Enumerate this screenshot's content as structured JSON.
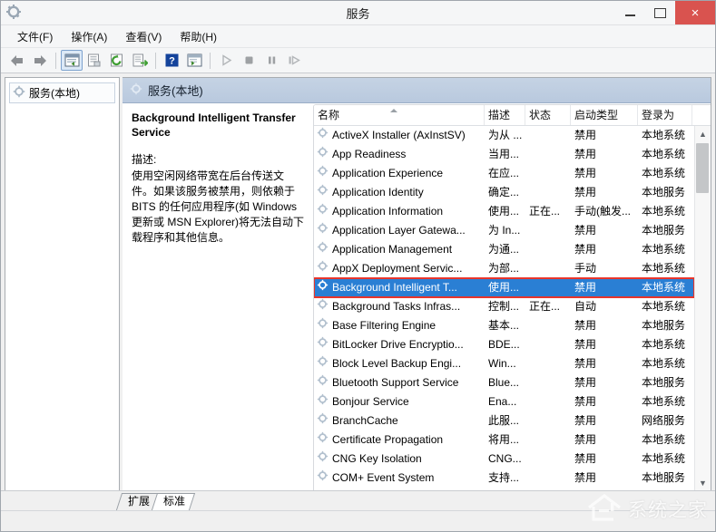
{
  "window": {
    "title": "服务",
    "icon": "gear-icon",
    "minimize_label": "最小化",
    "maximize_label": "最大化",
    "close_label": "×"
  },
  "menu": {
    "items": [
      {
        "label": "文件(F)",
        "name": "menu-file"
      },
      {
        "label": "操作(A)",
        "name": "menu-action"
      },
      {
        "label": "查看(V)",
        "name": "menu-view"
      },
      {
        "label": "帮助(H)",
        "name": "menu-help"
      }
    ]
  },
  "toolbar": {
    "buttons": [
      {
        "icon": "back-arrow-icon",
        "enabled": true
      },
      {
        "icon": "forward-arrow-icon",
        "enabled": true
      },
      {
        "icon": "show-console-tree-icon",
        "enabled": true,
        "active": true
      },
      {
        "icon": "properties-icon",
        "enabled": true
      },
      {
        "icon": "refresh-icon",
        "enabled": true
      },
      {
        "icon": "export-list-icon",
        "enabled": true
      },
      {
        "icon": "help-icon",
        "enabled": true
      },
      {
        "icon": "show-hide-action-pane-icon",
        "enabled": true
      },
      {
        "icon": "start-service-icon",
        "enabled": false
      },
      {
        "icon": "stop-service-icon",
        "enabled": false
      },
      {
        "icon": "pause-service-icon",
        "enabled": false
      },
      {
        "icon": "resume-service-icon",
        "enabled": false
      }
    ]
  },
  "tree": {
    "items": [
      {
        "label": "服务(本地)",
        "icon": "gear-icon"
      }
    ]
  },
  "pane": {
    "header_title": "服务(本地)",
    "header_icon": "gear-icon"
  },
  "detail": {
    "title": "Background Intelligent Transfer Service",
    "description_label": "描述:",
    "description_body": "使用空闲网络带宽在后台传送文件。如果该服务被禁用，则依赖于 BITS 的任何应用程序(如 Windows 更新或 MSN Explorer)将无法自动下载程序和其他信息。"
  },
  "list": {
    "columns": [
      {
        "label": "名称",
        "name": "column-name",
        "sorted": "asc"
      },
      {
        "label": "描述",
        "name": "column-description"
      },
      {
        "label": "状态",
        "name": "column-status"
      },
      {
        "label": "启动类型",
        "name": "column-startup-type"
      },
      {
        "label": "登录为",
        "name": "column-log-on-as"
      }
    ],
    "rows": [
      {
        "name": "ActiveX Installer (AxInstSV)",
        "desc": "为从 ...",
        "state": "",
        "start": "禁用",
        "logon": "本地系统",
        "selected": false
      },
      {
        "name": "App Readiness",
        "desc": "当用...",
        "state": "",
        "start": "禁用",
        "logon": "本地系统",
        "selected": false
      },
      {
        "name": "Application Experience",
        "desc": "在应...",
        "state": "",
        "start": "禁用",
        "logon": "本地系统",
        "selected": false
      },
      {
        "name": "Application Identity",
        "desc": "确定...",
        "state": "",
        "start": "禁用",
        "logon": "本地服务",
        "selected": false
      },
      {
        "name": "Application Information",
        "desc": "使用...",
        "state": "正在...",
        "start": "手动(触发...",
        "logon": "本地系统",
        "selected": false
      },
      {
        "name": "Application Layer Gatewa...",
        "desc": "为 In...",
        "state": "",
        "start": "禁用",
        "logon": "本地服务",
        "selected": false
      },
      {
        "name": "Application Management",
        "desc": "为通...",
        "state": "",
        "start": "禁用",
        "logon": "本地系统",
        "selected": false
      },
      {
        "name": "AppX Deployment Servic...",
        "desc": "为部...",
        "state": "",
        "start": "手动",
        "logon": "本地系统",
        "selected": false
      },
      {
        "name": "Background Intelligent T...",
        "desc": "使用...",
        "state": "",
        "start": "禁用",
        "logon": "本地系统",
        "selected": true
      },
      {
        "name": "Background Tasks Infras...",
        "desc": "控制...",
        "state": "正在...",
        "start": "自动",
        "logon": "本地系统",
        "selected": false
      },
      {
        "name": "Base Filtering Engine",
        "desc": "基本...",
        "state": "",
        "start": "禁用",
        "logon": "本地服务",
        "selected": false
      },
      {
        "name": "BitLocker Drive Encryptio...",
        "desc": "BDE...",
        "state": "",
        "start": "禁用",
        "logon": "本地系统",
        "selected": false
      },
      {
        "name": "Block Level Backup Engi...",
        "desc": "Win...",
        "state": "",
        "start": "禁用",
        "logon": "本地系统",
        "selected": false
      },
      {
        "name": "Bluetooth Support Service",
        "desc": "Blue...",
        "state": "",
        "start": "禁用",
        "logon": "本地服务",
        "selected": false
      },
      {
        "name": "Bonjour Service",
        "desc": "Ena...",
        "state": "",
        "start": "禁用",
        "logon": "本地系统",
        "selected": false
      },
      {
        "name": "BranchCache",
        "desc": "此服...",
        "state": "",
        "start": "禁用",
        "logon": "网络服务",
        "selected": false
      },
      {
        "name": "Certificate Propagation",
        "desc": "将用...",
        "state": "",
        "start": "禁用",
        "logon": "本地系统",
        "selected": false
      },
      {
        "name": "CNG Key Isolation",
        "desc": "CNG...",
        "state": "",
        "start": "禁用",
        "logon": "本地系统",
        "selected": false
      },
      {
        "name": "COM+ Event System",
        "desc": "支持...",
        "state": "",
        "start": "禁用",
        "logon": "本地服务",
        "selected": false
      }
    ]
  },
  "tabs": [
    {
      "label": "扩展",
      "name": "tab-extended",
      "active": false
    },
    {
      "label": "标准",
      "name": "tab-standard",
      "active": true
    }
  ],
  "watermark": {
    "text": "系统之家",
    "logo": "house-logo-icon"
  },
  "colors": {
    "selection": "#2a7fd4",
    "highlight_box": "#e8352b",
    "close_button": "#d9534f",
    "pane_header": "#bfcdde"
  }
}
